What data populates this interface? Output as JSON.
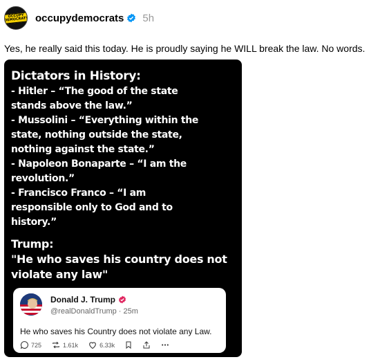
{
  "post": {
    "username": "occupydemocrats",
    "timestamp": "5h",
    "avatar_text": "OCCUPY DEMOCRATS",
    "caption": "Yes, he really said this today. He is proudly saying he WILL break the law. No words."
  },
  "image": {
    "title": "Dictators in History:",
    "lines": [
      "- Hitler – “The good of the state",
      "stands above the law.”",
      "- Mussolini – “Everything within the",
      "state, nothing outside the state,",
      "nothing against the state.”",
      "- Napoleon Bonaparte – “I am the",
      "revolution.”",
      "- Francisco Franco – “I am",
      "responsible only to God and to",
      "history.”"
    ],
    "trump_label": "Trump:",
    "trump_quote_line1": "\"He who saves his country does not",
    "trump_quote_line2": "violate any law\""
  },
  "tweet": {
    "name": "Donald J. Trump",
    "handle": "@realDonaldTrump · 25m",
    "body": "He who saves his Country does not violate any Law.",
    "replies": "725",
    "reposts": "1.61k",
    "likes": "6.33k"
  },
  "colors": {
    "verified_blue": "#0095f6",
    "tweet_badge_pink": "#e0245e",
    "media_bg": "#000000",
    "muted_text": "#999999"
  }
}
